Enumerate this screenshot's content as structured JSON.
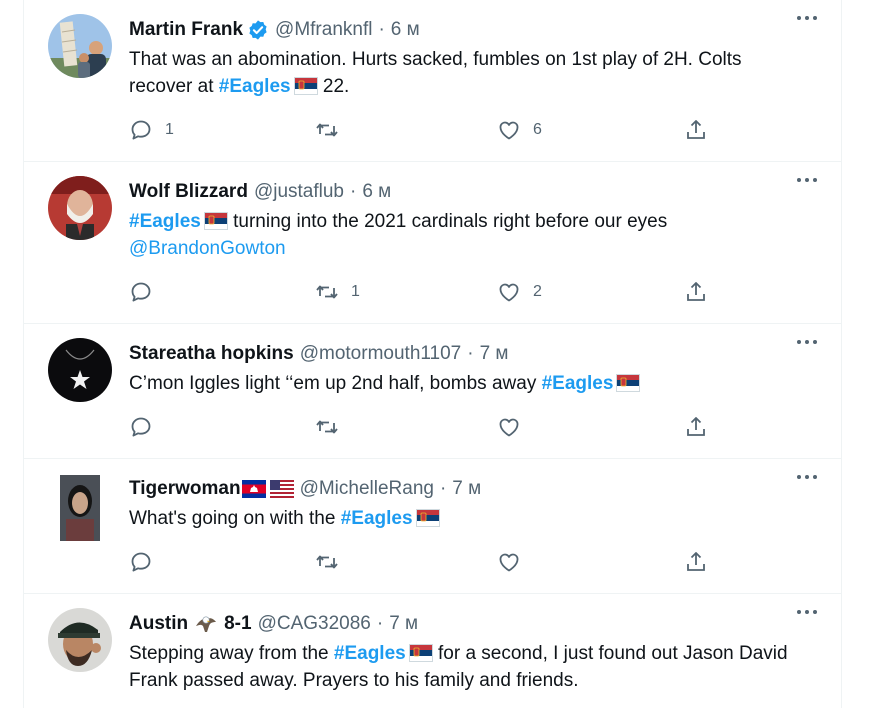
{
  "colors": {
    "link": "#1d9bf0",
    "text": "#0f1419",
    "muted": "#536471",
    "divider": "#eff3f4"
  },
  "tweets": [
    {
      "name": "Martin Frank",
      "handle": "@Mfranknfl",
      "time": "6 м",
      "verified": true,
      "text_a": "That was an abomination. Hurts sacked, fumbles on 1st play of 2H. Colts recover at ",
      "hashtag": "#Eagles",
      "text_b": " 22.",
      "replies": "1",
      "retweets": "",
      "likes": "6"
    },
    {
      "name": "Wolf Blizzard",
      "handle": "@justaflub",
      "time": "6 м",
      "hashtag": "#Eagles",
      "text_b": " turning into the 2021 cardinals right before our eyes",
      "mention": "@BrandonGowton",
      "replies": "",
      "retweets": "1",
      "likes": "2"
    },
    {
      "name": "Stareatha hopkins",
      "handle": "@motormouth1107",
      "time": "7 м",
      "text_a": "C’mon Iggles light ‘‘em up 2nd half, bombs away ",
      "hashtag": "#Eagles",
      "replies": "",
      "retweets": "",
      "likes": ""
    },
    {
      "name": "Tigerwoman",
      "handle": "@MichelleRang",
      "time": "7 м",
      "text_a": "What's going on with the ",
      "hashtag": "#Eagles",
      "replies": "",
      "retweets": "",
      "likes": ""
    },
    {
      "name": "Austin",
      "name_suffix": "8-1",
      "handle": "@CAG32086",
      "time": "7 м",
      "text_a": "Stepping away from the ",
      "hashtag": "#Eagles",
      "text_b": " for a second, I just found out Jason David Frank passed away. Prayers to his family and friends.",
      "replies": "",
      "retweets": "",
      "likes": ""
    }
  ]
}
